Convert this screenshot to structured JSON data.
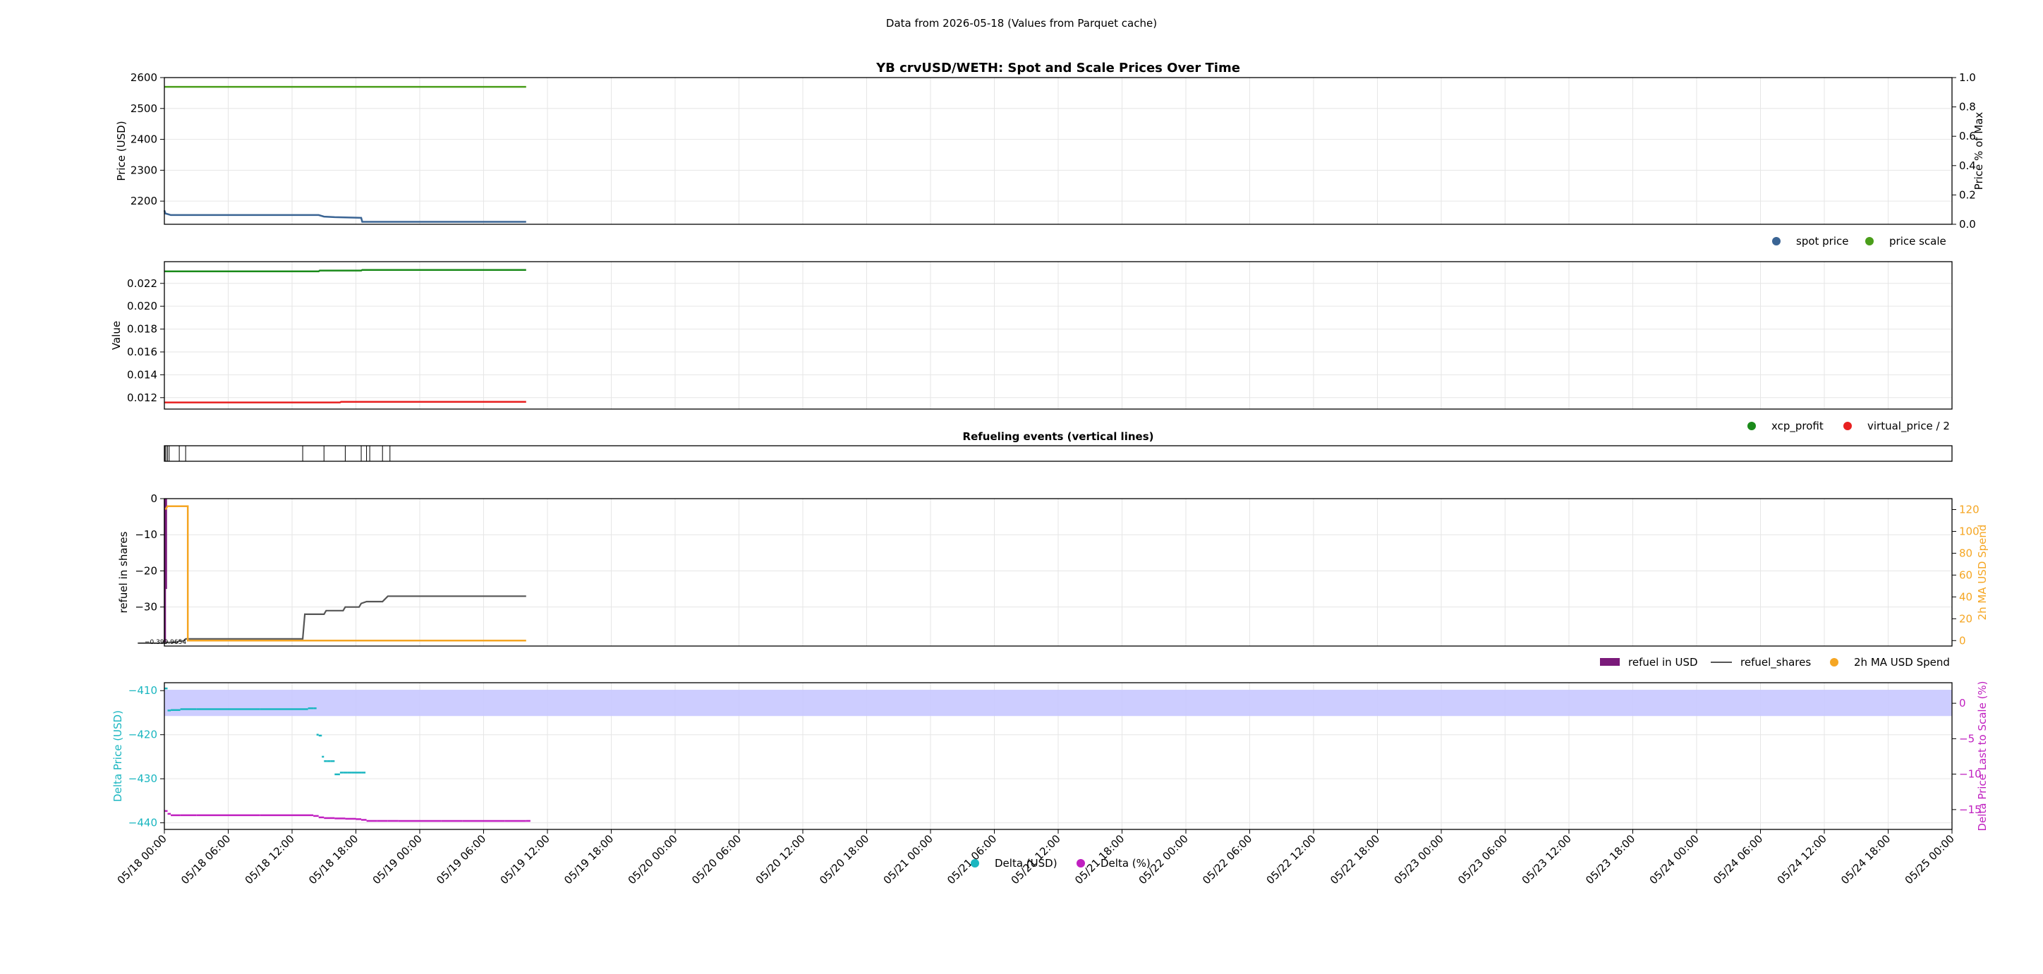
{
  "suptitle": "Data from 2026-05-18 (Values from Parquet cache)",
  "colors": {
    "spot": "#3a6494",
    "scale": "#4a9e1a",
    "xcp": "#1a8a1a",
    "virtual": "#e82020",
    "refuel_usd": "#7a1a7a",
    "refuel_shares": "#555555",
    "ma": "#f5a623",
    "delta_usd": "#1ab6c0",
    "delta_pct": "#c020c0",
    "band": "#c8c8ff",
    "grid": "#e6e6e6"
  },
  "x_ticks": [
    "05/18 00:00",
    "05/18 06:00",
    "05/18 12:00",
    "05/18 18:00",
    "05/19 00:00",
    "05/19 06:00",
    "05/19 12:00",
    "05/19 18:00",
    "05/20 00:00",
    "05/20 06:00",
    "05/20 12:00",
    "05/20 18:00",
    "05/21 00:00",
    "05/21 06:00",
    "05/21 12:00",
    "05/21 18:00",
    "05/22 00:00",
    "05/22 06:00",
    "05/22 12:00",
    "05/22 18:00",
    "05/23 00:00",
    "05/23 06:00",
    "05/23 12:00",
    "05/23 18:00",
    "05/24 00:00",
    "05/24 06:00",
    "05/24 12:00",
    "05/24 18:00",
    "05/25 00:00"
  ],
  "chart_data": [
    {
      "type": "line",
      "title": "YB crvUSD/WETH: Spot and Scale Prices Over Time",
      "ylabel": "Price (USD)",
      "y2label": "Price % of Max",
      "xlim_hours": [
        0,
        168
      ],
      "ylim": [
        2125,
        2600
      ],
      "y_ticks": [
        2200,
        2300,
        2400,
        2500,
        2600
      ],
      "y2lim": [
        0,
        1
      ],
      "y2_ticks": [
        "0.0",
        "0.2",
        "0.4",
        "0.6",
        "0.8",
        "1.0"
      ],
      "grid": true,
      "legend": "bottom-right",
      "legend_labels": [
        "spot price",
        "price scale"
      ],
      "series": [
        {
          "name": "spot price",
          "x": [
            0,
            0.1,
            0.3,
            0.6,
            1,
            14.5,
            15,
            16,
            18.5,
            18.6,
            34
          ],
          "y": [
            2170,
            2160,
            2158,
            2155,
            2155,
            2155,
            2150,
            2148,
            2146,
            2133,
            2133
          ]
        },
        {
          "name": "price scale",
          "x": [
            0,
            34
          ],
          "y": [
            2570,
            2570
          ]
        }
      ]
    },
    {
      "type": "line",
      "ylabel": "Value",
      "xlim_hours": [
        0,
        168
      ],
      "ylim": [
        0.011,
        0.0239
      ],
      "y_ticks": [
        "0.012",
        "0.014",
        "0.016",
        "0.018",
        "0.020",
        "0.022"
      ],
      "grid": true,
      "legend": "bottom-right",
      "legend_labels": [
        "xcp_profit",
        "virtual_price / 2"
      ],
      "series": [
        {
          "name": "xcp_profit",
          "x": [
            0,
            14.5,
            14.6,
            18.5,
            18.6,
            34
          ],
          "y": [
            0.02305,
            0.02305,
            0.02312,
            0.02312,
            0.02318,
            0.02318
          ]
        },
        {
          "name": "virtual_price / 2",
          "x": [
            0,
            16.5,
            16.6,
            34
          ],
          "y": [
            0.01158,
            0.01158,
            0.01163,
            0.01163
          ]
        }
      ]
    },
    {
      "type": "line",
      "title": "Refueling events (vertical lines)",
      "xlim_hours": [
        0,
        168
      ],
      "events_hours": [
        0.05,
        0.15,
        0.3,
        0.45,
        1.4,
        2.0,
        13.0,
        15.0,
        17.0,
        18.5,
        19.0,
        19.3,
        20.5,
        21.2
      ]
    },
    {
      "type": "line",
      "ylabel": "refuel in shares",
      "y2label": "2h MA USD Spend",
      "xlim_hours": [
        0,
        168
      ],
      "ylim": [
        -40.8,
        0
      ],
      "y_ticks": [
        "0",
        "−10",
        "−20",
        "−30"
      ],
      "y2lim": [
        -5,
        130
      ],
      "y2_ticks": [
        "0",
        "20",
        "40",
        "60",
        "80",
        "100",
        "120"
      ],
      "grid": true,
      "legend": "bottom-right",
      "legend_labels": [
        "refuel in USD",
        "refuel_shares",
        "2h MA USD Spend"
      ],
      "annotation": "−0.399.9654",
      "series": [
        {
          "name": "refuel in USD",
          "kind": "bar",
          "x": [
            0.05,
            0.15
          ],
          "y": [
            -40,
            -25
          ]
        },
        {
          "name": "refuel_shares",
          "x": [
            -2.5,
            0.1,
            0.2,
            1.2,
            1.4,
            1.8,
            2.0,
            13.0,
            13.2,
            15.0,
            15.2,
            16.8,
            17.0,
            18.3,
            18.5,
            19.0,
            20.5,
            21.0,
            34
          ],
          "y": [
            -40,
            -40,
            -39.8,
            -39.8,
            -39.4,
            -39.4,
            -38.8,
            -38.8,
            -32.0,
            -32.0,
            -31.0,
            -31.0,
            -30.0,
            -30.0,
            -29.0,
            -28.5,
            -28.5,
            -27.0,
            -27.0
          ]
        },
        {
          "name": "2h MA USD Spend",
          "axis": "y2",
          "x": [
            0.1,
            0.3,
            2.2,
            2.2,
            34
          ],
          "y": [
            120,
            123,
            123,
            0,
            0
          ]
        }
      ]
    },
    {
      "type": "scatter",
      "ylabel": "Delta Price (USD)",
      "y2label": "Delta Price Last to Scale (%)",
      "xlim_hours": [
        0,
        168
      ],
      "ylim": [
        -441.5,
        -408.2
      ],
      "y_ticks": [
        "−410",
        "−420",
        "−430",
        "−440"
      ],
      "y2lim": [
        -17.8,
        2.9
      ],
      "y2_ticks": [
        "0",
        "−5",
        "−10",
        "−15"
      ],
      "band_y2": [
        -1.8,
        1.9
      ],
      "grid": true,
      "legend": "bottom-center",
      "legend_labels": [
        "Delta (USD)",
        "Delta (%)"
      ],
      "series": [
        {
          "name": "Delta (USD)",
          "x": [
            0,
            0.3,
            0.6,
            1.5,
            3,
            6,
            9,
            12,
            13.5,
            14,
            14.3,
            14.5,
            14.8,
            15.0,
            15.3,
            15.6,
            16.0,
            16.5,
            16.8,
            17.2,
            17.6,
            18.0,
            18.5
          ],
          "y": [
            -409.5,
            -414.5,
            -414.4,
            -414.2,
            -414.2,
            -414.2,
            -414.2,
            -414.2,
            -414.0,
            -414.0,
            -420.0,
            -420.2,
            -425.0,
            -426.0,
            -426.0,
            -426.0,
            -429.0,
            -428.6,
            -428.6,
            -428.6,
            -428.6,
            -428.6,
            -428.6
          ]
        },
        {
          "name": "Delta (%)",
          "x": [
            0,
            0.3,
            0.6,
            1.5,
            3,
            6,
            9,
            12,
            14,
            14.5,
            15,
            16,
            17,
            18,
            18.5,
            19,
            20,
            21,
            22,
            24,
            26,
            28,
            30,
            32,
            34
          ],
          "y": [
            -15.2,
            -15.6,
            -15.8,
            -15.8,
            -15.8,
            -15.8,
            -15.8,
            -15.8,
            -15.9,
            -16.1,
            -16.2,
            -16.25,
            -16.3,
            -16.35,
            -16.45,
            -16.6,
            -16.6,
            -16.6,
            -16.6,
            -16.6,
            -16.6,
            -16.6,
            -16.6,
            -16.6,
            -16.6
          ]
        }
      ]
    }
  ]
}
